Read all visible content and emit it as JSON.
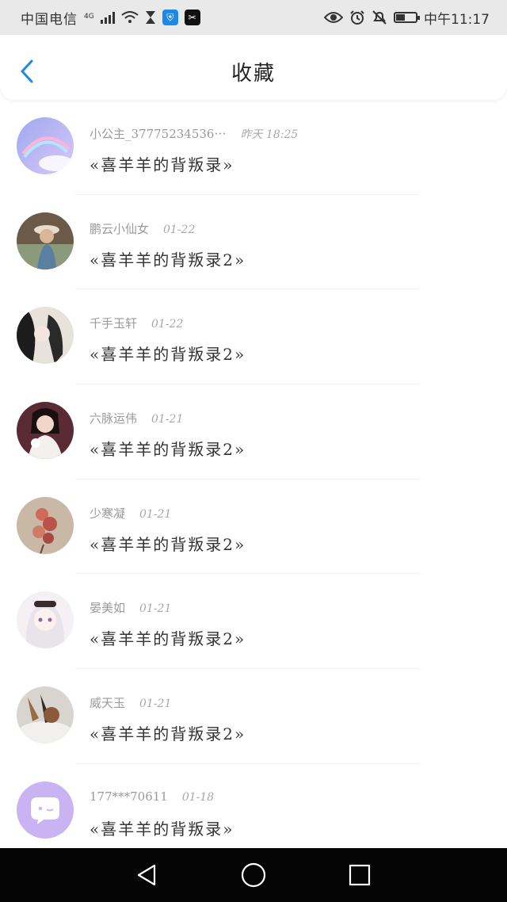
{
  "status_bar": {
    "carrier": "中国电信",
    "network": "4G",
    "time": "中午11:17",
    "battery_level": 0.45,
    "icons": [
      "signal-icon",
      "wifi-icon",
      "hourglass-icon",
      "shield-app-icon",
      "capcut-app-icon",
      "eye-icon",
      "alarm-icon",
      "mute-icon",
      "battery-icon"
    ]
  },
  "header": {
    "title": "收藏",
    "back_icon": "back-chevron-icon"
  },
  "items": [
    {
      "name": "小公主_37775234536⋯",
      "time": "昨天 18:25",
      "message": "«喜羊羊的背叛录»"
    },
    {
      "name": "鹏云小仙女",
      "time": "01-22",
      "message": "«喜羊羊的背叛录2»"
    },
    {
      "name": "千手玉轩",
      "time": "01-22",
      "message": "«喜羊羊的背叛录2»"
    },
    {
      "name": "六脉运伟",
      "time": "01-21",
      "message": "«喜羊羊的背叛录2»"
    },
    {
      "name": "少寒凝",
      "time": "01-21",
      "message": "«喜羊羊的背叛录2»"
    },
    {
      "name": "晏美如",
      "time": "01-21",
      "message": "«喜羊羊的背叛录2»"
    },
    {
      "name": "威天玉",
      "time": "01-21",
      "message": "«喜羊羊的背叛录2»"
    },
    {
      "name": "177***70611",
      "time": "01-18",
      "message": "«喜羊羊的背叛录»"
    }
  ],
  "nav_bar": {
    "icons": [
      "back-triangle-icon",
      "home-circle-icon",
      "recent-square-icon"
    ]
  },
  "colors": {
    "accent": "#1e88e5",
    "status_bg": "#e9e9e9",
    "nav_bg": "#050505"
  }
}
